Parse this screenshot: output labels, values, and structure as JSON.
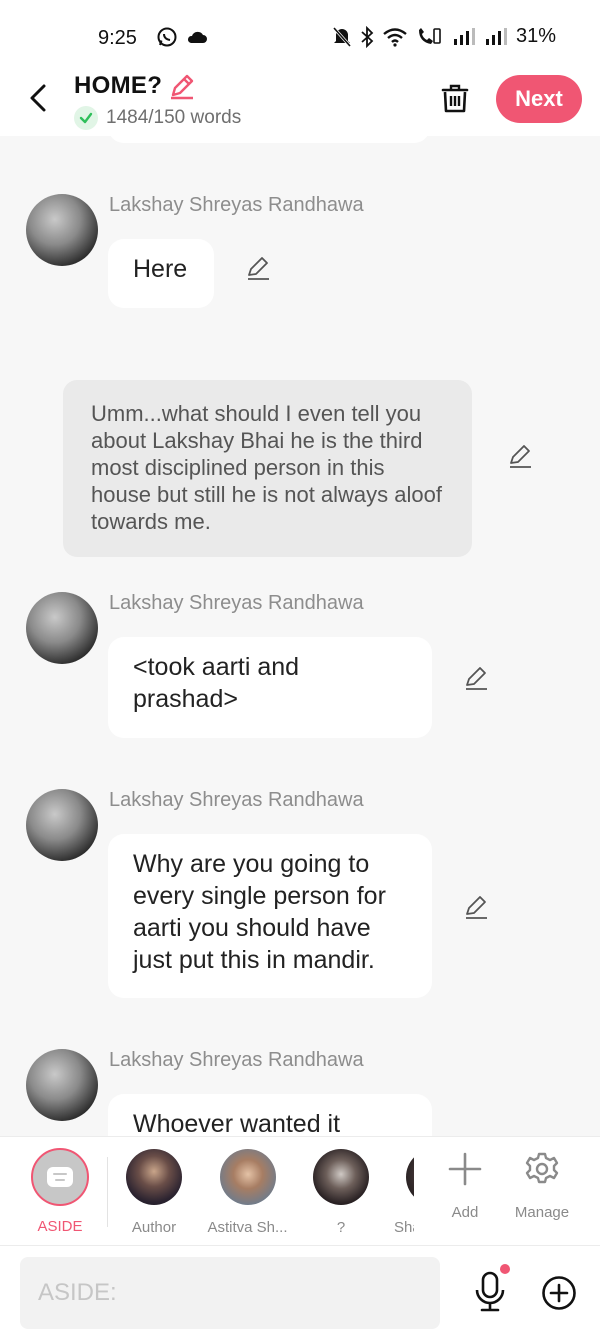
{
  "status_bar": {
    "time": "9:25",
    "battery": "31%"
  },
  "header": {
    "title": "HOME?",
    "word_count": "1484/150 words",
    "next_label": "Next"
  },
  "messages": [
    {
      "sender": "Lakshay Shreyas Randhawa",
      "text": "Here"
    },
    {
      "sender": "Lakshay Shreyas Randhawa",
      "text": "<took aarti and prashad>"
    },
    {
      "sender": "Lakshay Shreyas Randhawa",
      "text": "Why are you going to every single person for aarti you should have just put this in mandir."
    },
    {
      "sender": "Lakshay Shreyas Randhawa",
      "text": "Whoever wanted it"
    }
  ],
  "aside_message": "Umm...what should I even tell you about Lakshay Bhai he is the third most disciplined person in this house but still he is not always aloof towards me.",
  "character_bar": {
    "items": [
      {
        "label": "ASIDE"
      },
      {
        "label": "Author"
      },
      {
        "label": "Astitva Sh..."
      },
      {
        "label": "?"
      },
      {
        "label": "Sha"
      },
      {
        "label": "Add"
      },
      {
        "label": "Manage"
      }
    ]
  },
  "input": {
    "placeholder": "ASIDE:"
  },
  "colors": {
    "accent": "#f05673",
    "background": "#f7f7f7",
    "bubble": "#ffffff",
    "aside_bubble": "#eaeaea"
  }
}
